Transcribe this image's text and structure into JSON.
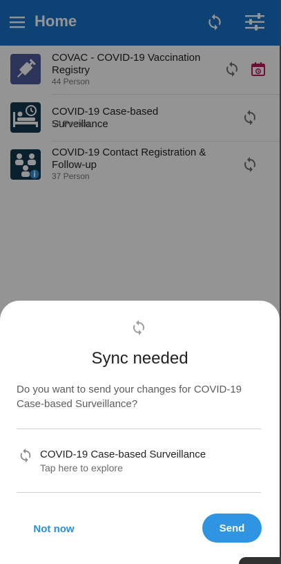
{
  "app_bar": {
    "title": "Home",
    "menu_icon": "menu-icon",
    "sync_icon": "sync-icon",
    "filter_icon": "filter-icon",
    "color": "#1a73c9"
  },
  "programs": [
    {
      "name": "COVAC - COVID-19 Vaccination Registry",
      "count": "44 Person",
      "icon": "syringe-icon",
      "icon_bg": "#4f5a9a",
      "has_calendar": true
    },
    {
      "name": "COVID-19 Case-based Surveillance",
      "count": "54 Person",
      "icon": "hospital-bed-icon",
      "icon_bg": "#123a4f",
      "has_calendar": false
    },
    {
      "name": "COVID-19 Contact Registration & Follow-up",
      "count": "37 Person",
      "icon": "contacts-icon",
      "icon_bg": "#123a4f",
      "has_calendar": false
    }
  ],
  "sheet": {
    "title": "Sync needed",
    "message": "Do you want to send your changes for COVID-19 Case-based Surveillance?",
    "item_name": "COVID-19 Case-based Surveillance",
    "item_hint": "Tap here to explore",
    "cancel_label": "Not now",
    "confirm_label": "Send",
    "accent": "#2f95e2"
  },
  "colors": {
    "calendar": "#c2185b",
    "scrim": "rgba(0,0,0,0.42)"
  }
}
